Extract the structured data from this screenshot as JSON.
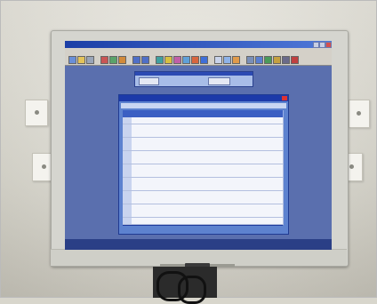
{
  "scene": {
    "description_text": ""
  },
  "monitor": {
    "brand_logo": "",
    "app": {
      "window_title": "",
      "menu": [
        "",
        "",
        "",
        "",
        ""
      ],
      "toolbar_icons": [
        "save-icon",
        "open-icon",
        "print-icon",
        "cut-icon",
        "copy-icon",
        "paste-icon",
        "undo-icon",
        "redo-icon",
        "grid-icon",
        "chart-icon",
        "filter-icon",
        "sort-icon",
        "refresh-icon",
        "help-icon"
      ],
      "status_left": "",
      "status_right": "",
      "subwindow": {
        "field_left": "",
        "field_right": ""
      },
      "dialog": {
        "title": "",
        "band": "",
        "table": {
          "headers": [
            "",
            "",
            "",
            "",
            ""
          ],
          "rows": [
            [
              "",
              "",
              "",
              "",
              ""
            ],
            [
              "",
              "",
              "",
              "",
              ""
            ],
            [
              "",
              "",
              "",
              "",
              ""
            ],
            [
              "",
              "",
              "",
              "",
              ""
            ],
            [
              "",
              "",
              "",
              "",
              ""
            ],
            [
              "",
              "",
              "",
              "",
              ""
            ],
            [
              "",
              "",
              "",
              "",
              ""
            ],
            [
              "",
              "",
              "",
              "",
              ""
            ],
            [
              "",
              "",
              "",
              "",
              ""
            ],
            [
              "",
              "",
              "",
              "",
              ""
            ],
            [
              "",
              "",
              "",
              "",
              ""
            ],
            [
              "",
              "",
              "",
              "",
              ""
            ],
            [
              "",
              "",
              "",
              "",
              ""
            ],
            [
              "",
              "",
              "",
              "",
              ""
            ],
            [
              "",
              "",
              "",
              "",
              ""
            ],
            [
              "",
              "",
              "",
              "",
              ""
            ]
          ]
        }
      }
    }
  },
  "colors": {
    "desktop": "#5a6fae",
    "titlebar": "#1b3ea6",
    "dialog": "#5d82cf",
    "grid_cell": "#f3f5fb"
  }
}
